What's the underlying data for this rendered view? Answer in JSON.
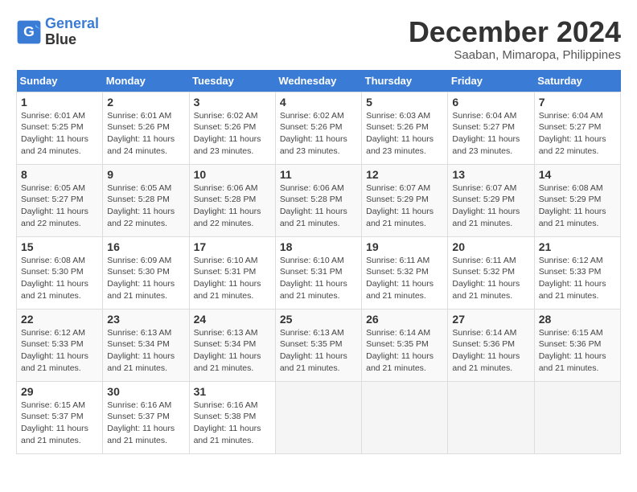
{
  "header": {
    "logo": "General Blue",
    "month": "December 2024",
    "location": "Saaban, Mimaropa, Philippines"
  },
  "days": [
    "Sunday",
    "Monday",
    "Tuesday",
    "Wednesday",
    "Thursday",
    "Friday",
    "Saturday"
  ],
  "weeks": [
    [
      {
        "num": "1",
        "info": "Sunrise: 6:01 AM\nSunset: 5:25 PM\nDaylight: 11 hours\nand 24 minutes."
      },
      {
        "num": "2",
        "info": "Sunrise: 6:01 AM\nSunset: 5:26 PM\nDaylight: 11 hours\nand 24 minutes."
      },
      {
        "num": "3",
        "info": "Sunrise: 6:02 AM\nSunset: 5:26 PM\nDaylight: 11 hours\nand 23 minutes."
      },
      {
        "num": "4",
        "info": "Sunrise: 6:02 AM\nSunset: 5:26 PM\nDaylight: 11 hours\nand 23 minutes."
      },
      {
        "num": "5",
        "info": "Sunrise: 6:03 AM\nSunset: 5:26 PM\nDaylight: 11 hours\nand 23 minutes."
      },
      {
        "num": "6",
        "info": "Sunrise: 6:04 AM\nSunset: 5:27 PM\nDaylight: 11 hours\nand 23 minutes."
      },
      {
        "num": "7",
        "info": "Sunrise: 6:04 AM\nSunset: 5:27 PM\nDaylight: 11 hours\nand 22 minutes."
      }
    ],
    [
      {
        "num": "8",
        "info": "Sunrise: 6:05 AM\nSunset: 5:27 PM\nDaylight: 11 hours\nand 22 minutes."
      },
      {
        "num": "9",
        "info": "Sunrise: 6:05 AM\nSunset: 5:28 PM\nDaylight: 11 hours\nand 22 minutes."
      },
      {
        "num": "10",
        "info": "Sunrise: 6:06 AM\nSunset: 5:28 PM\nDaylight: 11 hours\nand 22 minutes."
      },
      {
        "num": "11",
        "info": "Sunrise: 6:06 AM\nSunset: 5:28 PM\nDaylight: 11 hours\nand 21 minutes."
      },
      {
        "num": "12",
        "info": "Sunrise: 6:07 AM\nSunset: 5:29 PM\nDaylight: 11 hours\nand 21 minutes."
      },
      {
        "num": "13",
        "info": "Sunrise: 6:07 AM\nSunset: 5:29 PM\nDaylight: 11 hours\nand 21 minutes."
      },
      {
        "num": "14",
        "info": "Sunrise: 6:08 AM\nSunset: 5:29 PM\nDaylight: 11 hours\nand 21 minutes."
      }
    ],
    [
      {
        "num": "15",
        "info": "Sunrise: 6:08 AM\nSunset: 5:30 PM\nDaylight: 11 hours\nand 21 minutes."
      },
      {
        "num": "16",
        "info": "Sunrise: 6:09 AM\nSunset: 5:30 PM\nDaylight: 11 hours\nand 21 minutes."
      },
      {
        "num": "17",
        "info": "Sunrise: 6:10 AM\nSunset: 5:31 PM\nDaylight: 11 hours\nand 21 minutes."
      },
      {
        "num": "18",
        "info": "Sunrise: 6:10 AM\nSunset: 5:31 PM\nDaylight: 11 hours\nand 21 minutes."
      },
      {
        "num": "19",
        "info": "Sunrise: 6:11 AM\nSunset: 5:32 PM\nDaylight: 11 hours\nand 21 minutes."
      },
      {
        "num": "20",
        "info": "Sunrise: 6:11 AM\nSunset: 5:32 PM\nDaylight: 11 hours\nand 21 minutes."
      },
      {
        "num": "21",
        "info": "Sunrise: 6:12 AM\nSunset: 5:33 PM\nDaylight: 11 hours\nand 21 minutes."
      }
    ],
    [
      {
        "num": "22",
        "info": "Sunrise: 6:12 AM\nSunset: 5:33 PM\nDaylight: 11 hours\nand 21 minutes."
      },
      {
        "num": "23",
        "info": "Sunrise: 6:13 AM\nSunset: 5:34 PM\nDaylight: 11 hours\nand 21 minutes."
      },
      {
        "num": "24",
        "info": "Sunrise: 6:13 AM\nSunset: 5:34 PM\nDaylight: 11 hours\nand 21 minutes."
      },
      {
        "num": "25",
        "info": "Sunrise: 6:13 AM\nSunset: 5:35 PM\nDaylight: 11 hours\nand 21 minutes."
      },
      {
        "num": "26",
        "info": "Sunrise: 6:14 AM\nSunset: 5:35 PM\nDaylight: 11 hours\nand 21 minutes."
      },
      {
        "num": "27",
        "info": "Sunrise: 6:14 AM\nSunset: 5:36 PM\nDaylight: 11 hours\nand 21 minutes."
      },
      {
        "num": "28",
        "info": "Sunrise: 6:15 AM\nSunset: 5:36 PM\nDaylight: 11 hours\nand 21 minutes."
      }
    ],
    [
      {
        "num": "29",
        "info": "Sunrise: 6:15 AM\nSunset: 5:37 PM\nDaylight: 11 hours\nand 21 minutes."
      },
      {
        "num": "30",
        "info": "Sunrise: 6:16 AM\nSunset: 5:37 PM\nDaylight: 11 hours\nand 21 minutes."
      },
      {
        "num": "31",
        "info": "Sunrise: 6:16 AM\nSunset: 5:38 PM\nDaylight: 11 hours\nand 21 minutes."
      },
      null,
      null,
      null,
      null
    ]
  ]
}
